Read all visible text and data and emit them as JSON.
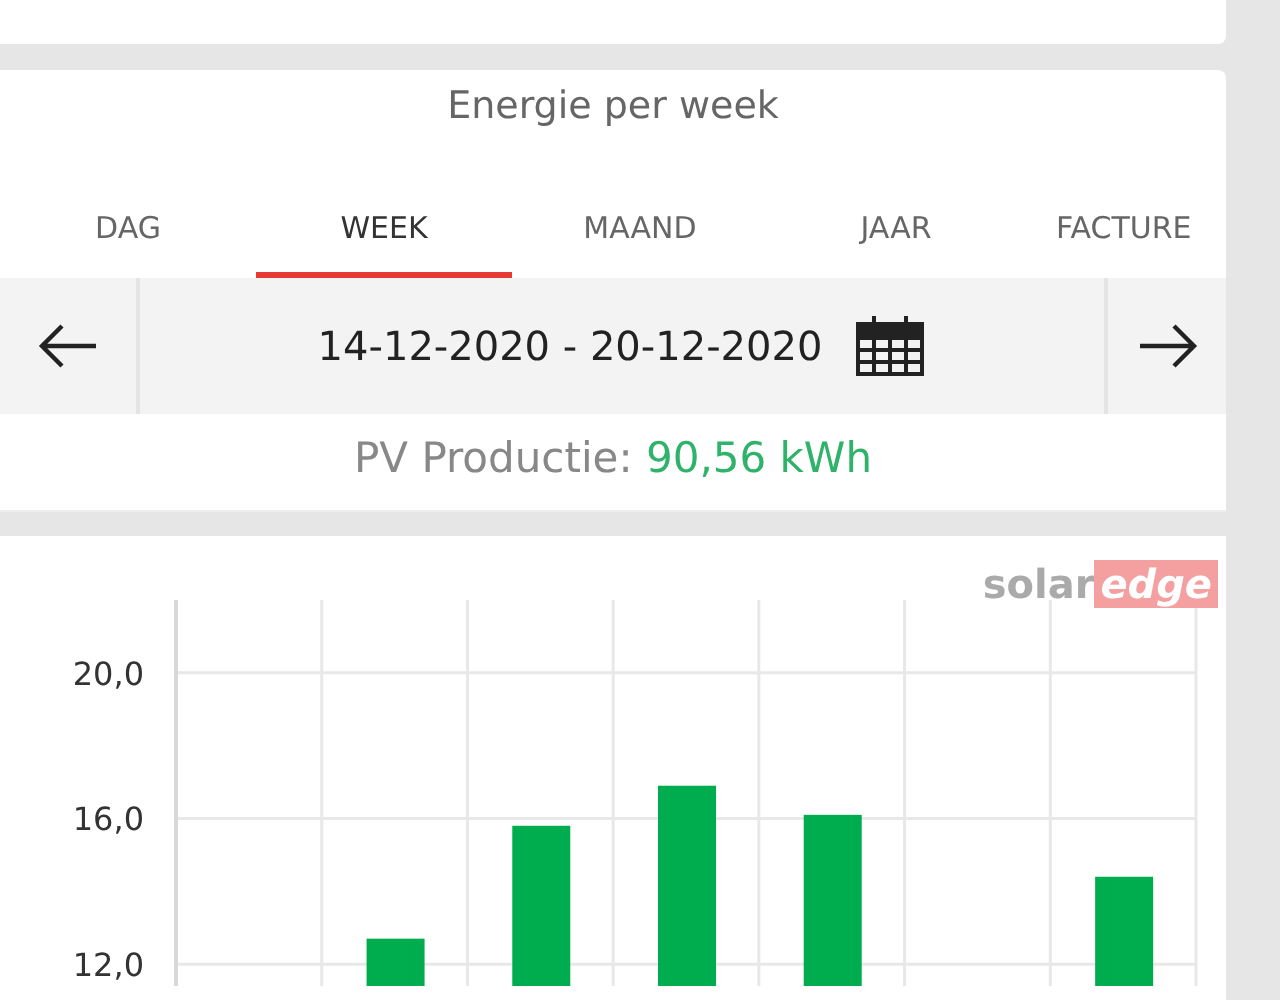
{
  "title": "Energie per week",
  "tabs": [
    {
      "label": "DAG",
      "selected": false
    },
    {
      "label": "WEEK",
      "selected": true
    },
    {
      "label": "MAAND",
      "selected": false
    },
    {
      "label": "JAAR",
      "selected": false
    },
    {
      "label": "FACTURE",
      "selected": false
    }
  ],
  "date_range": "14-12-2020 - 20-12-2020",
  "production": {
    "label": "PV Productie:",
    "value": "90,56 kWh"
  },
  "logo": {
    "part_1": "solar",
    "part_2": "edge"
  },
  "chart_data": {
    "type": "bar",
    "grid": true,
    "series": [
      {
        "color": "#00ad4e",
        "values": [
          null,
          12.7,
          15.8,
          16.9,
          16.1,
          null,
          14.4
        ]
      }
    ],
    "ylim": [
      11.4,
      22
    ],
    "yticks": [
      {
        "value": 12,
        "label": "12,0"
      },
      {
        "value": 16,
        "label": "16,0"
      },
      {
        "value": 20,
        "label": "20,0"
      }
    ]
  }
}
